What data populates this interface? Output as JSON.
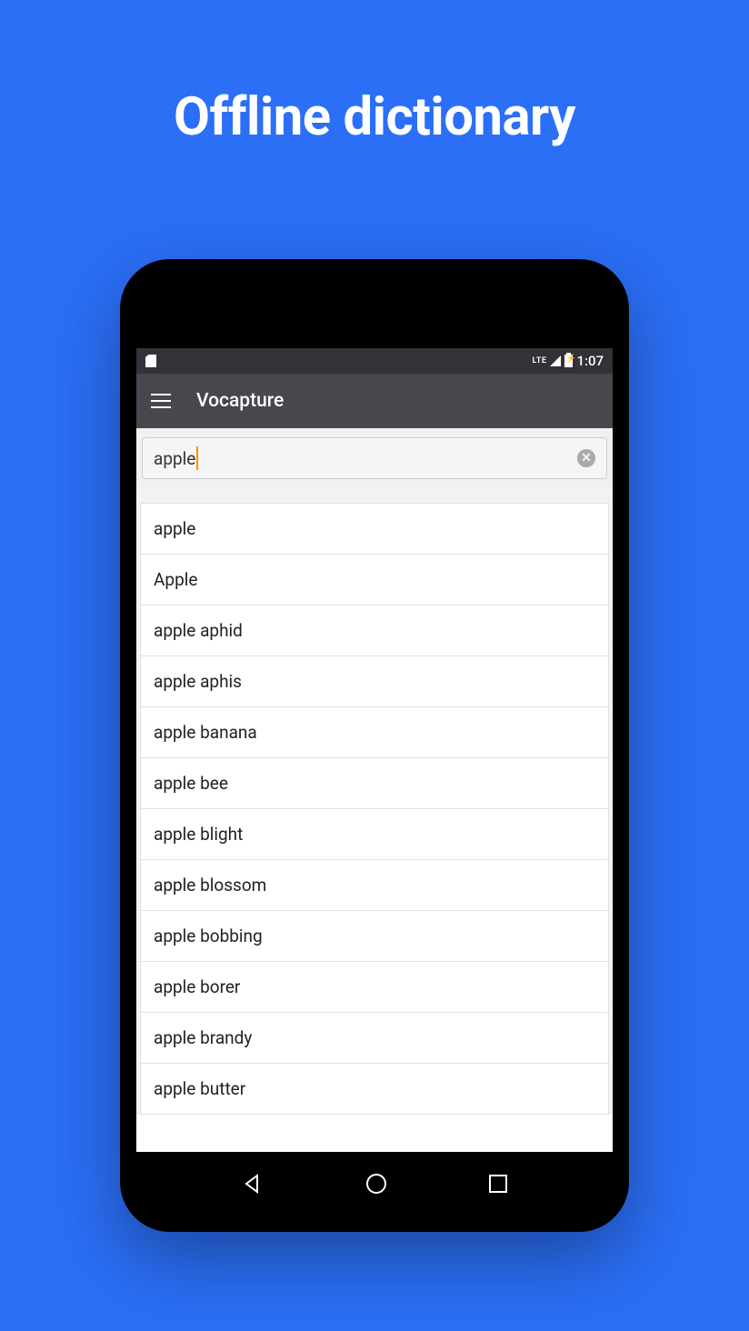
{
  "headline": "Offline dictionary",
  "statusBar": {
    "lte": "LTE",
    "time": "1:07"
  },
  "appBar": {
    "title": "Vocapture"
  },
  "search": {
    "value": "apple"
  },
  "results": [
    "apple",
    "Apple",
    "apple aphid",
    "apple aphis",
    "apple banana",
    "apple bee",
    "apple blight",
    "apple blossom",
    "apple bobbing",
    "apple borer",
    "apple brandy",
    "apple butter"
  ]
}
